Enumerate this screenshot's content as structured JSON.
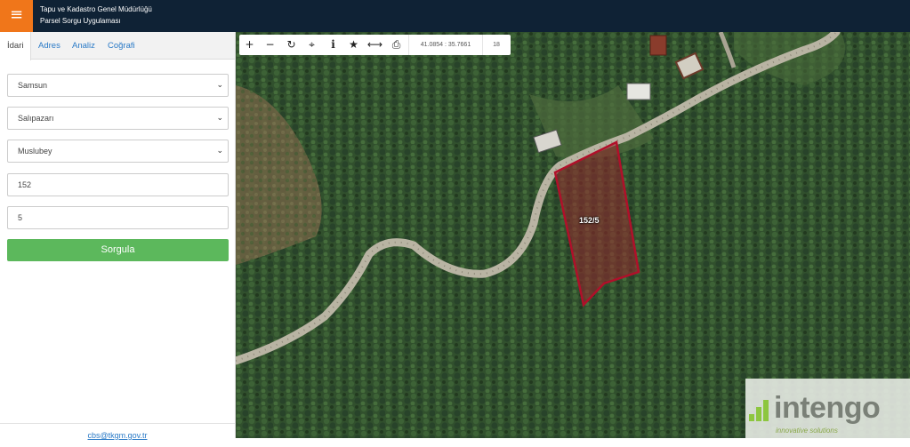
{
  "header": {
    "menu_icon": "≡",
    "title_line1": "Tapu ve Kadastro Genel Müdürlüğü",
    "title_line2": "Parsel Sorgu Uygulaması"
  },
  "sidebar": {
    "tabs": [
      {
        "label": "İdari"
      },
      {
        "label": "Adres"
      },
      {
        "label": "Analiz"
      },
      {
        "label": "Coğrafi"
      }
    ],
    "province": "Samsun",
    "district": "Salıpazarı",
    "neighborhood": "Muslubey",
    "block": "152",
    "parcel": "5",
    "query_button": "Sorgula",
    "footer_link": "cbs@tkgm.gov.tr"
  },
  "map": {
    "toolbar": {
      "icons": [
        "plus-icon",
        "minus-icon",
        "refresh-icon",
        "locate-icon",
        "info-icon",
        "star-icon",
        "measure-icon",
        "print-icon"
      ],
      "glyphs": [
        "+",
        "−",
        "↻",
        "⌖",
        "i",
        "★",
        "⟷",
        "⎙"
      ],
      "coordinates": "41.0854 : 35.7661",
      "zoom": "18"
    },
    "parcel_label": "152/5",
    "watermark": {
      "brand": "intengo",
      "tagline": "innovative solutions"
    }
  },
  "colors": {
    "topbar": "#0f2235",
    "menu_accent": "#f0761a",
    "query_button": "#5cb85c",
    "parcel_outline": "#b0102a",
    "link": "#2a7ac7"
  }
}
